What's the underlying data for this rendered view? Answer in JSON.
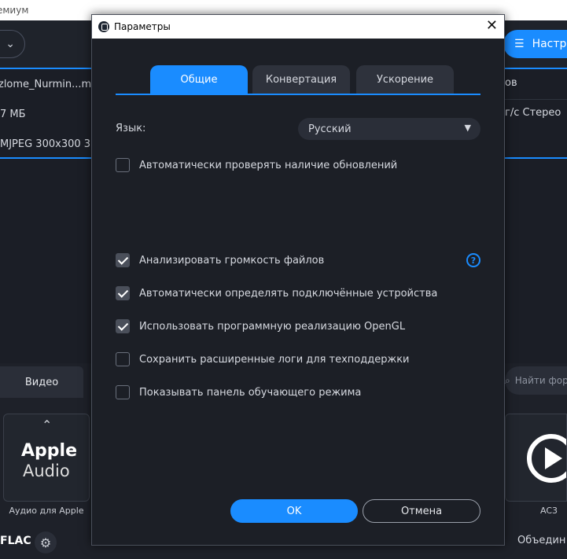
{
  "background": {
    "window_title": "емиум",
    "settings_button": "Настр",
    "file": {
      "name": "zlome_Nurmin...m_",
      "size": "7 МБ",
      "video_info": "MJPEG 300x300 3",
      "right_col_1": "ов",
      "right_col_2": "г/с Стерео"
    },
    "tab_video": "Видео",
    "search_placeholder": "Найти форм",
    "card_apple": {
      "line1": "Apple",
      "line2": "Audio",
      "label": "Аудио для Apple"
    },
    "card_ac3_label": "AC3",
    "format": "FLAC",
    "merge": "Объедин"
  },
  "dialog": {
    "title": "Параметры",
    "tabs": [
      {
        "label": "Общие",
        "active": true
      },
      {
        "label": "Конвертация",
        "active": false
      },
      {
        "label": "Ускорение",
        "active": false
      }
    ],
    "language_label": "Язык:",
    "language_value": "Русский",
    "options": [
      {
        "label": "Автоматически проверять наличие обновлений",
        "checked": false
      },
      {
        "label": "Анализировать громкость файлов",
        "checked": true
      },
      {
        "label": "Автоматически определять подключённые устройства",
        "checked": true
      },
      {
        "label": "Использовать программную реализацию OpenGL",
        "checked": true
      },
      {
        "label": "Сохранить расширенные логи для техподдержки",
        "checked": false
      },
      {
        "label": "Показывать панель обучающего режима",
        "checked": false
      }
    ],
    "help_glyph": "?",
    "ok_label": "OK",
    "cancel_label": "Отмена"
  },
  "colors": {
    "accent": "#1a8cff",
    "background": "#1c1f26"
  }
}
